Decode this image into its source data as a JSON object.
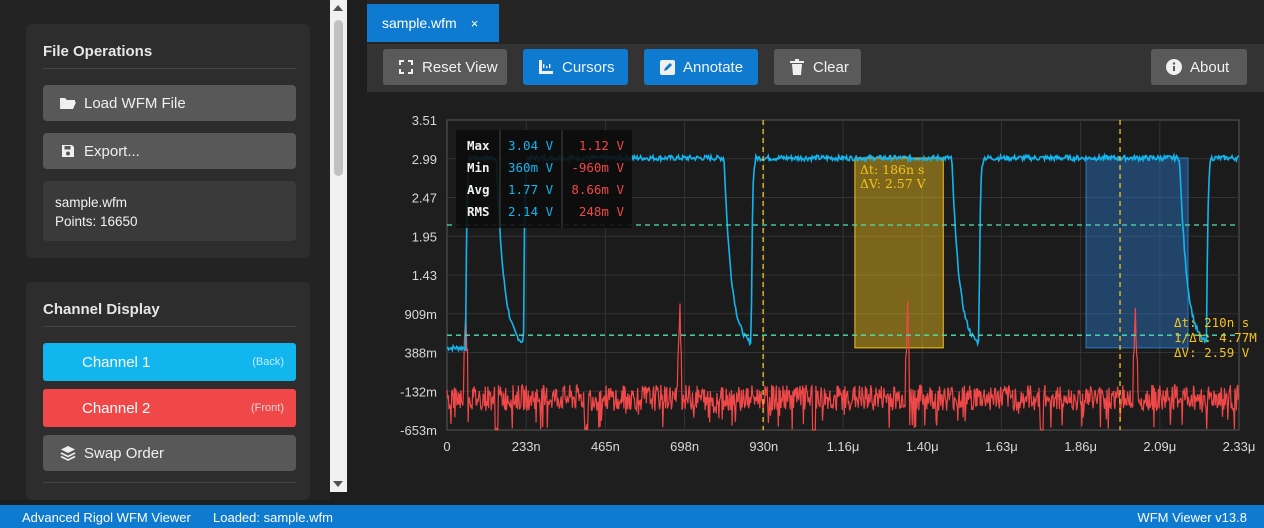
{
  "sidebar": {
    "file_ops": {
      "title": "File Operations",
      "load_label": "Load WFM File",
      "export_label": "Export...",
      "file_name": "sample.wfm",
      "points": "Points: 16650"
    },
    "channel_display": {
      "title": "Channel Display",
      "channel1": {
        "label": "Channel 1",
        "tag": "(Back)",
        "color": "#12b6ef"
      },
      "channel2": {
        "label": "Channel 2",
        "tag": "(Front)",
        "color": "#f04848"
      },
      "swap_label": "Swap Order"
    }
  },
  "tabs": [
    {
      "label": "sample.wfm",
      "close": "×"
    }
  ],
  "toolbar": {
    "reset_label": "Reset View",
    "cursors_label": "Cursors",
    "annotate_label": "Annotate",
    "clear_label": "Clear",
    "about_label": "About"
  },
  "measurements": {
    "rows": [
      "Max",
      "Min",
      "Avg",
      "RMS"
    ],
    "ch1": [
      "3.04 V",
      "360m V",
      "1.77 V",
      "2.14 V"
    ],
    "ch2": [
      "1.12 V",
      "-960m V",
      "8.66m V",
      "248m V"
    ]
  },
  "annotation_yellow": {
    "dt": "Δt: 186n s",
    "dv": "ΔV: 2.57 V"
  },
  "cursor_readout": {
    "dt": "Δt: 210n s",
    "freq": "1/Δt: 4.77M Hz",
    "dv": "ΔV: 2.59 V"
  },
  "chart_data": {
    "type": "line",
    "x_tick_labels": [
      "0",
      "233n",
      "465n",
      "698n",
      "930n",
      "1.16μ",
      "1.40μ",
      "1.63μ",
      "1.86μ",
      "2.09μ",
      "2.33μ"
    ],
    "y_tick_labels": [
      "3.51",
      "2.99",
      "2.47",
      "1.95",
      "1.43",
      "909m",
      "388m",
      "-132m",
      "-653m"
    ],
    "xlim": [
      0,
      2.33e-06
    ],
    "ylim": [
      -0.653,
      3.51
    ],
    "grid": true,
    "series": [
      {
        "name": "Channel 1",
        "color": "#12b6ef",
        "low": 0.45,
        "high": 3.0,
        "rise_times": [
          5.5e-08,
          2.25e-07,
          8.95e-07,
          1.565e-06,
          2.235e-06
        ],
        "fall_times": [
          1.45e-07,
          8.15e-07,
          1.485e-06,
          2.155e-06
        ]
      },
      {
        "name": "Channel 2",
        "color": "#f04848",
        "baseline": -0.22,
        "spike_times": [
          5.5e-08,
          6.85e-07,
          1.355e-06,
          2.025e-06
        ],
        "dip_times": [
          1.45e-07,
          4.1e-07,
          1.08e-06,
          1.75e-06,
          2.42e-06
        ]
      }
    ],
    "vertical_cursors": [
      9.3e-07,
      1.98e-06
    ],
    "horizontal_cursors": [
      2.1,
      0.62
    ],
    "highlight_regions": [
      {
        "x0": 1.2e-06,
        "x1": 1.46e-06,
        "y0": 0.45,
        "y1": 3.0,
        "color": "#f3c31c"
      },
      {
        "x0": 1.88e-06,
        "x1": 2.18e-06,
        "y0": 0.45,
        "y1": 3.0,
        "color": "#2a78c8"
      }
    ]
  },
  "status": {
    "app_name": "Advanced Rigol WFM Viewer",
    "loaded": "Loaded: sample.wfm",
    "version": "WFM Viewer v13.8"
  }
}
